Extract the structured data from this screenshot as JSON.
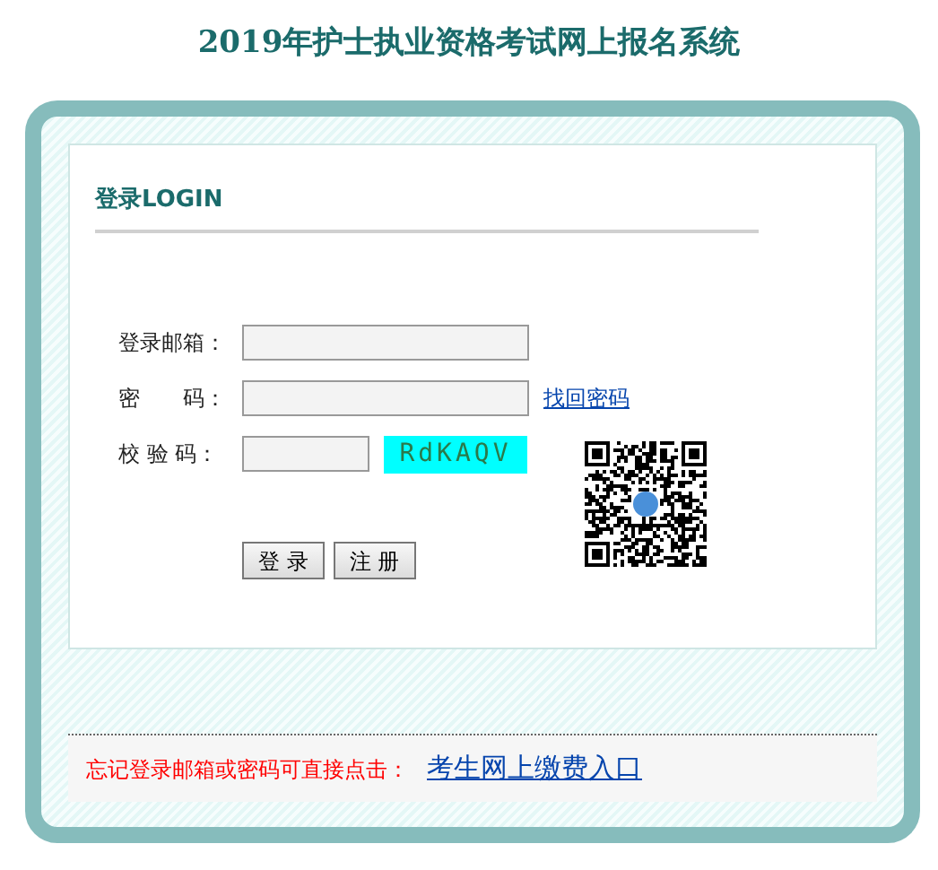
{
  "title": "2019年护士执业资格考试网上报名系统",
  "login": {
    "heading": "登录LOGIN",
    "fields": [
      {
        "label": "登录邮箱：",
        "kind": "text"
      },
      {
        "label": "密　　码：",
        "kind": "password",
        "link": "找回密码"
      },
      {
        "label": "校 验 码：",
        "kind": "captcha",
        "captcha": "RdKAQV"
      }
    ],
    "buttons": [
      "登 录",
      "注 册"
    ]
  },
  "footer": {
    "note": "忘记登录邮箱或密码可直接点击：",
    "link": "考生网上缴费入口"
  }
}
